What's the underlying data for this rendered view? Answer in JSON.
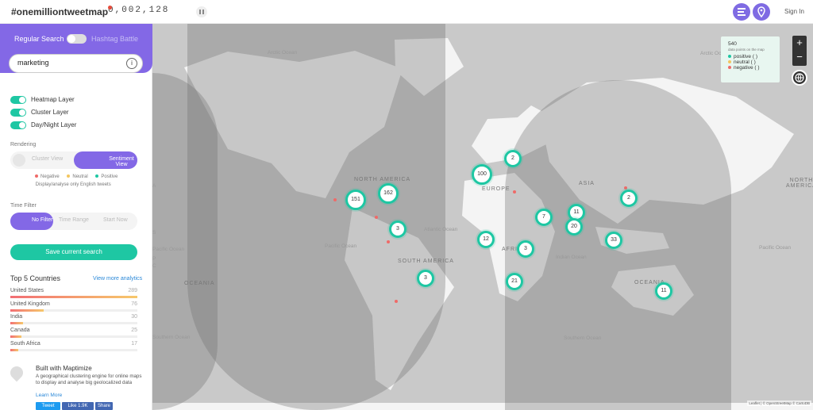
{
  "app": {
    "title": "#onemilliontweetmap",
    "counter": "0,002,128",
    "signin": "Sign In"
  },
  "sidebar": {
    "regular_search": "Regular Search",
    "hashtag_battle": "Hashtag Battle",
    "search": {
      "value": "marketing",
      "info_icon": "info-icon"
    },
    "layers": [
      {
        "label": "Heatmap Layer",
        "enabled": true
      },
      {
        "label": "Cluster Layer",
        "enabled": true
      },
      {
        "label": "Day/Night Layer",
        "enabled": true
      }
    ],
    "rendering": "Rendering",
    "cluster_view": "Cluster View",
    "sentiment_view": "Sentiment View",
    "sentiments": [
      "Negative",
      "Neutral",
      "Positive"
    ],
    "english_note": "Display/analyse only English tweets",
    "time_filter": "Time Filter",
    "time_options": [
      "No Filter",
      "Time Range",
      "Start Now"
    ],
    "save_button": "Save current search",
    "top_countries": "Top 5 Countries",
    "view_more": "View more analytics",
    "countries": [
      {
        "name": "United States",
        "count": "289",
        "fraction": 1.0
      },
      {
        "name": "United Kingdom",
        "count": "76",
        "fraction": 0.26
      },
      {
        "name": "India",
        "count": "30",
        "fraction": 0.1
      },
      {
        "name": "Canada",
        "count": "25",
        "fraction": 0.09
      },
      {
        "name": "South Africa",
        "count": "17",
        "fraction": 0.06
      }
    ],
    "built": "Built with Maptimize",
    "description": "A geographical clustering engine for online maps to display and analyse big geolocalized data",
    "learn": "Learn More",
    "social": [
      "Tweet",
      "Like 1.9K",
      "Share"
    ]
  },
  "map": {
    "regions": [
      "Arctic Ocean",
      "NORTH AMERICA",
      "Atlantic Ocean",
      "Pacific Ocean",
      "SOUTH AMERICA",
      "EUROPE",
      "ASIA",
      "AFRICA",
      "Indian Ocean",
      "OCEANIA",
      "Southern Ocean",
      "Arctic Ocean",
      "Pacific Ocean",
      "OCEANIA",
      "Southern Ocean",
      "Pacific Ocean",
      "NORTH AMERICA",
      "A",
      "S",
      "P",
      "C"
    ],
    "clusters": [
      "151",
      "162",
      "100",
      "2",
      "2",
      "7",
      "11",
      "20",
      "3",
      "12",
      "3",
      "21",
      "33",
      "11",
      "3"
    ],
    "info": {
      "count": "540",
      "subtitle": "data points on the map",
      "positive": "positive ( )",
      "neutral": "neutral ( )",
      "negative": "negative ( )"
    },
    "zoom_in": "+",
    "zoom_out": "−",
    "attribution": "Leaflet | © OpenStreetMap © CartoDB"
  }
}
